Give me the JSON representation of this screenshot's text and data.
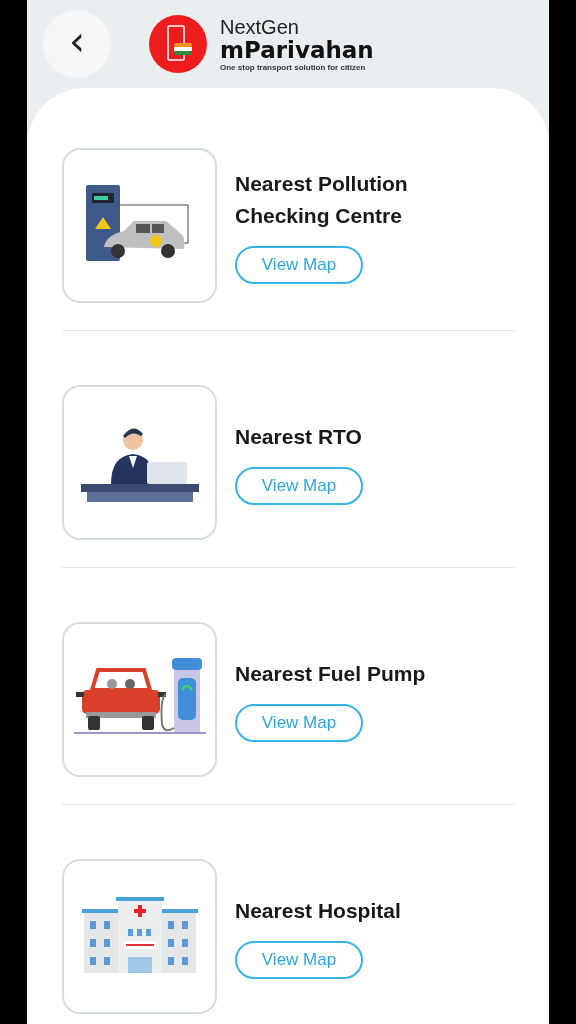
{
  "header": {
    "back_symbol": "‹",
    "brand_top": "NextGen",
    "brand_name": "mParivahan",
    "tagline": "One stop transport solution for citizen"
  },
  "items": [
    {
      "kind": "ev-charger",
      "title": "Nearest Pollution Checking Centre",
      "button": "View Map"
    },
    {
      "kind": "rto-desk",
      "title": "Nearest RTO",
      "button": "View Map"
    },
    {
      "kind": "fuel-pump",
      "title": "Nearest Fuel Pump",
      "button": "View Map"
    },
    {
      "kind": "hospital",
      "title": "Nearest Hospital",
      "button": "View Map"
    }
  ]
}
